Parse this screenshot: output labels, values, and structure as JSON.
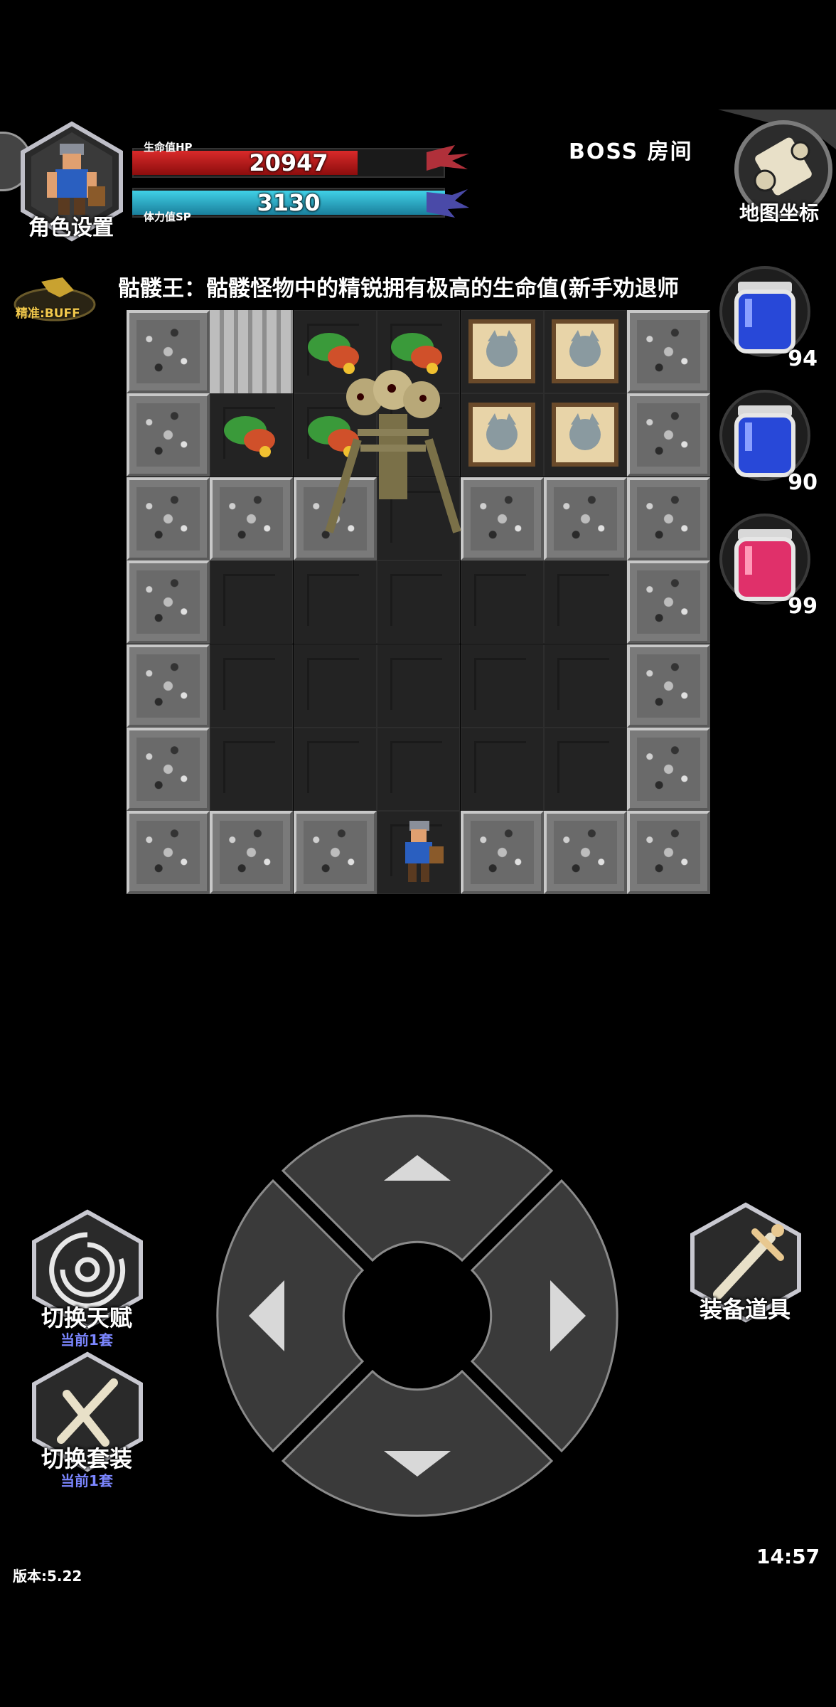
{
  "hud": {
    "character_settings_label": "角色设置",
    "hp": {
      "caption": "生命值HP",
      "value": "20947",
      "fill_ratio": 0.72
    },
    "sp": {
      "caption": "体力值SP",
      "value": "3130",
      "fill_ratio": 1.0
    },
    "room_label": "BOSS  房间",
    "map_label": "地图坐标",
    "buff_label": "精准:BUFF",
    "notice": "骷髅王：骷髅怪物中的精锐拥有极高的生命值(新手劝退师"
  },
  "potions": [
    {
      "name": "blue-potion",
      "count": "94",
      "color": "#2848d8"
    },
    {
      "name": "blue-potion",
      "count": "90",
      "color": "#2848d8"
    },
    {
      "name": "red-potion",
      "count": "99",
      "color": "#e0306a"
    }
  ],
  "controls": {
    "switch_talent": {
      "label": "切换天赋",
      "sub": "当前1套"
    },
    "switch_set": {
      "label": "切换套装",
      "sub": "当前1套"
    },
    "equip_items": {
      "label": "装备道具"
    }
  },
  "footer": {
    "version": "版本:5.22",
    "clock": "14:57"
  },
  "colors": {
    "hp": "#d92a2a",
    "sp": "#40d0e6",
    "sub_text": "#7b86ff"
  }
}
